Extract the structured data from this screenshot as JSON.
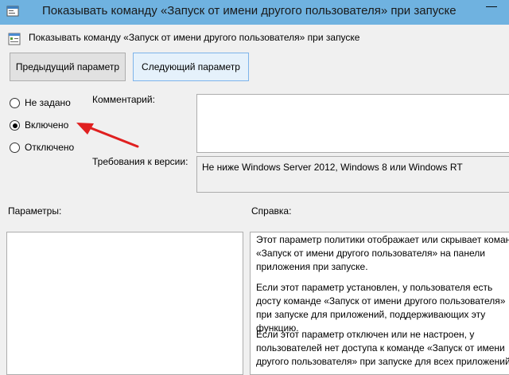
{
  "window": {
    "title": "Показывать команду «Запуск от имени другого пользователя» при запуске",
    "minimize_glyph": "—"
  },
  "header": {
    "policy_name": "Показывать команду «Запуск от имени другого пользователя» при запуске"
  },
  "nav": {
    "prev_label": "Предыдущий параметр",
    "next_label": "Следующий параметр"
  },
  "state": {
    "options": [
      {
        "label": "Не задано",
        "checked": false
      },
      {
        "label": "Включено",
        "checked": true
      },
      {
        "label": "Отключено",
        "checked": false
      }
    ]
  },
  "comment": {
    "label": "Комментарий:",
    "value": ""
  },
  "version": {
    "label": "Требования к версии:",
    "value": "Не ниже Windows Server 2012, Windows 8 или Windows RT"
  },
  "options_panel": {
    "label": "Параметры:"
  },
  "help_panel": {
    "label": "Справка:",
    "paragraphs": [
      "Этот параметр политики отображает или скрывает коман, «Запуск от имени другого пользователя» на панели приложения при запуске.",
      "Если этот параметр установлен, у пользователя есть досту команде «Запуск от имени другого пользователя» при запуске для приложений, поддерживающих эту функцию.",
      "Если этот параметр отключен или не настроен, у пользователей нет доступа к команде «Запуск от имени другого пользователя» при запуске для всех приложений."
    ]
  },
  "colors": {
    "titlebar": "#6fb2e0",
    "annotation_arrow": "#e02020"
  }
}
